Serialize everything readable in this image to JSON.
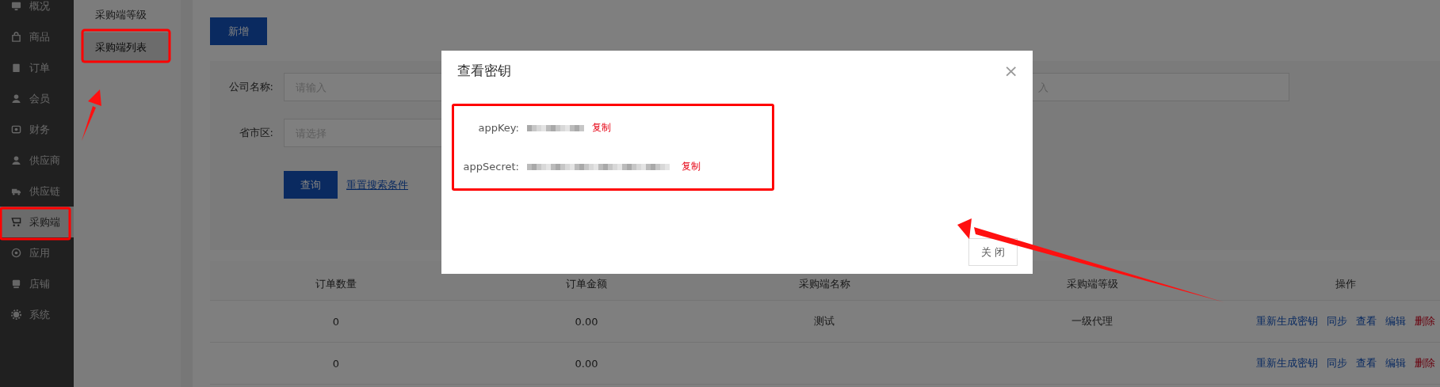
{
  "sidebar": {
    "items": [
      {
        "label": "概况",
        "selected": false
      },
      {
        "label": "商品",
        "selected": false
      },
      {
        "label": "订单",
        "selected": false
      },
      {
        "label": "会员",
        "selected": false
      },
      {
        "label": "财务",
        "selected": false
      },
      {
        "label": "供应商",
        "selected": false
      },
      {
        "label": "供应链",
        "selected": false
      },
      {
        "label": "采购端",
        "selected": true
      },
      {
        "label": "应用",
        "selected": false
      },
      {
        "label": "店铺",
        "selected": false
      },
      {
        "label": "系统",
        "selected": false
      }
    ]
  },
  "subnav": {
    "items": [
      {
        "label": "采购端等级",
        "selected": false
      },
      {
        "label": "采购端列表",
        "selected": true
      }
    ]
  },
  "add_button": "新增",
  "filters": [
    {
      "label": "公司名称:",
      "placeholder": "请输入"
    },
    {
      "placeholder": "入"
    },
    {
      "label": "省市区:",
      "placeholder": "请选择"
    }
  ],
  "query_button": "查询",
  "reset_link": "重置搜索条件",
  "table": {
    "columns": [
      "订单数量",
      "订单金额",
      "采购端名称",
      "采购端等级",
      "操作"
    ],
    "rows": [
      {
        "cells": [
          "0",
          "0.00",
          "测试",
          "一级代理"
        ],
        "actions": [
          {
            "label": "重新生成密钥",
            "kind": "link"
          },
          {
            "label": "同步",
            "kind": "link"
          },
          {
            "label": "查看",
            "kind": "link"
          },
          {
            "label": "编辑",
            "kind": "link"
          },
          {
            "label": "删除",
            "kind": "danger"
          }
        ]
      },
      {
        "cells": [
          "0",
          "0.00",
          "",
          ""
        ],
        "actions": [
          {
            "label": "重新生成密钥",
            "kind": "link"
          },
          {
            "label": "同步",
            "kind": "link"
          },
          {
            "label": "查看",
            "kind": "link"
          },
          {
            "label": "编辑",
            "kind": "link"
          },
          {
            "label": "删除",
            "kind": "danger"
          }
        ]
      }
    ]
  },
  "modal": {
    "title": "查看密钥",
    "close_icon": "×",
    "fields": [
      {
        "label": "appKey:",
        "masked": true,
        "copy": "复制"
      },
      {
        "label": "appSecret:",
        "masked": true,
        "copy": "复制"
      }
    ],
    "close_button": "关 闭"
  }
}
